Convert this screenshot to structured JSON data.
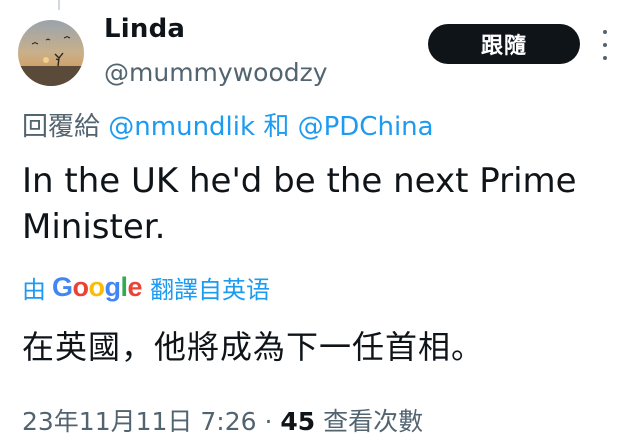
{
  "author": {
    "name": "Linda",
    "handle": "@mummywoodzy"
  },
  "follow_label": "跟隨",
  "reply": {
    "prefix": "回覆給",
    "mention1": "@nmundlik",
    "conjunction": "和",
    "mention2": "@PDChina"
  },
  "tweet": {
    "text": "In the UK he'd be the next Prime Minister."
  },
  "translation": {
    "prefix": "由",
    "google_letters": [
      "G",
      "o",
      "o",
      "g",
      "l",
      "e"
    ],
    "google_colors": [
      "#4285F4",
      "#EA4335",
      "#FBBC05",
      "#4285F4",
      "#34A853",
      "#EA4335"
    ],
    "suffix": "翻譯自英语",
    "text": "在英國，他將成為下一任首相。"
  },
  "meta": {
    "date": "23年11月11日",
    "time": "7:26",
    "separator": "·",
    "views_count": "45",
    "views_label": "查看次數"
  },
  "colors": {
    "link": "#1d9bf0",
    "secondary_text": "#536471",
    "primary_text": "#0f1419",
    "button_bg": "#0f1419"
  }
}
